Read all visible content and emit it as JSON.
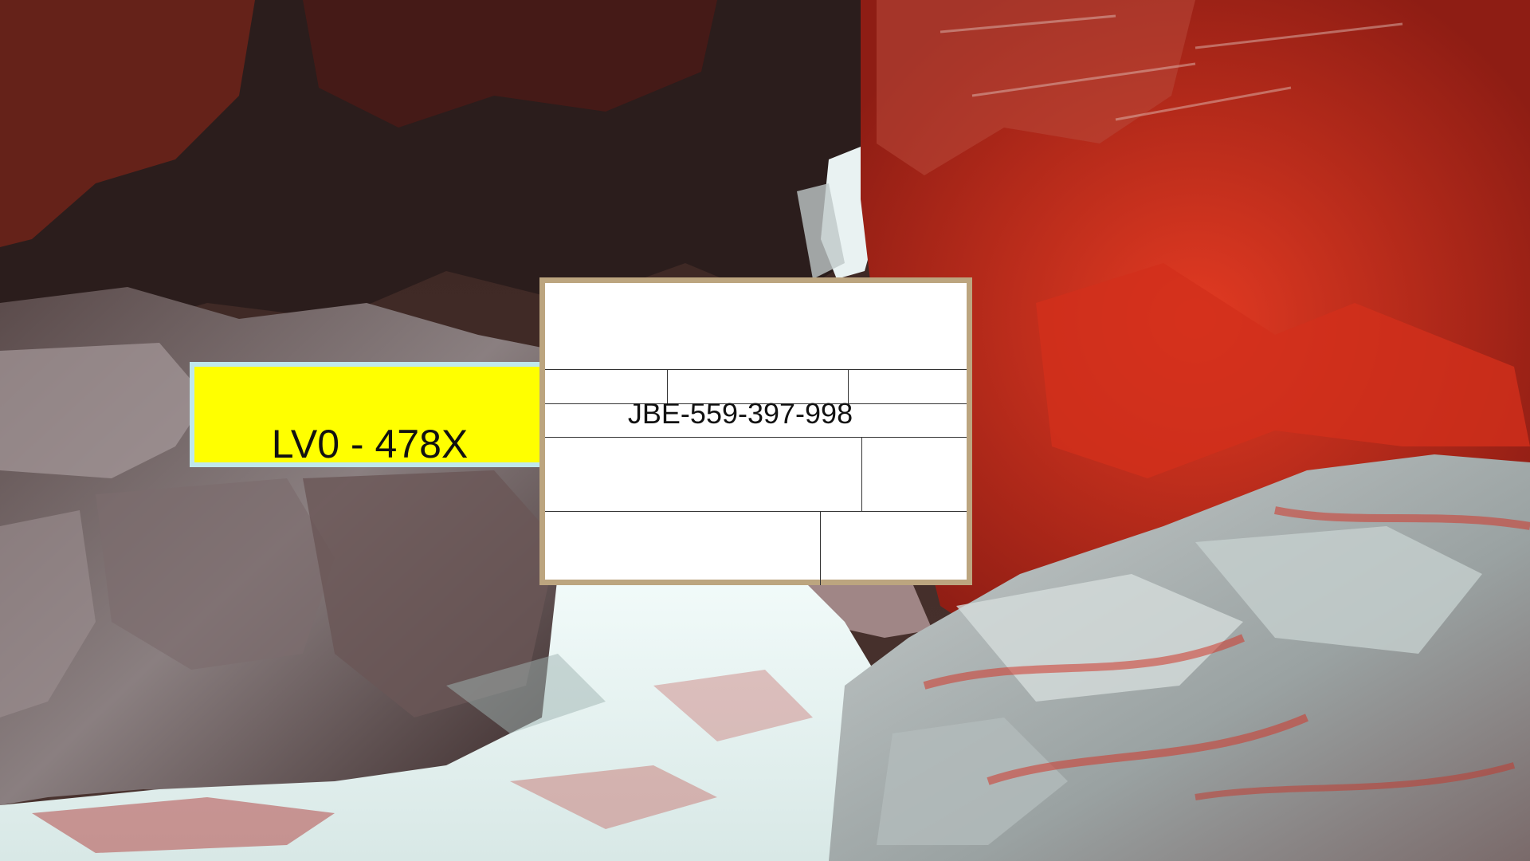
{
  "scene": {
    "description_icon": "river-gorge-photo",
    "colors": {
      "foliage": "#c8281a",
      "rock": "#9a9a9a",
      "water": "#e8f4f2",
      "dark": "#2a1b1b"
    }
  },
  "plate": {
    "text": "LV0 - 478X",
    "background": "#ffff00",
    "border": "#bfe8ec"
  },
  "form": {
    "code": "JBE-559-397-998",
    "frame_color": "#bca57f"
  }
}
